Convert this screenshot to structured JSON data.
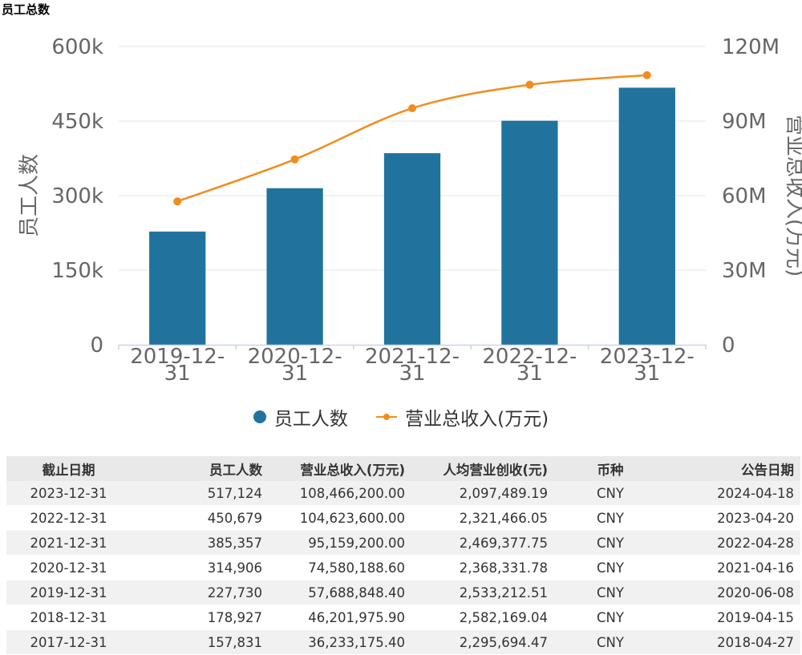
{
  "page_title": "员工总数",
  "chart_data": {
    "type": "bar+line",
    "categories": [
      "2019-12-31",
      "2020-12-31",
      "2021-12-31",
      "2022-12-31",
      "2023-12-31"
    ],
    "category_lines": [
      [
        "2019-12-",
        "31"
      ],
      [
        "2020-12-",
        "31"
      ],
      [
        "2021-12-",
        "31"
      ],
      [
        "2022-12-",
        "31"
      ],
      [
        "2023-12-",
        "31"
      ]
    ],
    "series": [
      {
        "name": "员工人数",
        "type": "bar",
        "axis": "left",
        "values": [
          227730,
          314906,
          385357,
          450679,
          517124
        ],
        "color": "#21739e"
      },
      {
        "name": "营业总收入(万元)",
        "type": "line",
        "axis": "right",
        "values": [
          57688848.4,
          74580188.6,
          95159200.0,
          104623600.0,
          108466200.0
        ],
        "color": "#f28d1d"
      }
    ],
    "ylabel_left": "员工人数",
    "ylabel_right": "营业总收入(万元)",
    "ylim_left": [
      0,
      600000
    ],
    "ylim_right": [
      0,
      120000000
    ],
    "yticks_left": [
      "0",
      "150k",
      "300k",
      "450k",
      "600k"
    ],
    "yticks_right": [
      "0",
      "30M",
      "60M",
      "90M",
      "120M"
    ],
    "grid": true,
    "legend_position": "bottom"
  },
  "table": {
    "headers": [
      "截止日期",
      "员工人数",
      "营业总收入(万元)",
      "人均营业创收(元)",
      "币种",
      "公告日期"
    ],
    "rows": [
      [
        "2023-12-31",
        "517,124",
        "108,466,200.00",
        "2,097,489.19",
        "CNY",
        "2024-04-18"
      ],
      [
        "2022-12-31",
        "450,679",
        "104,623,600.00",
        "2,321,466.05",
        "CNY",
        "2023-04-20"
      ],
      [
        "2021-12-31",
        "385,357",
        "95,159,200.00",
        "2,469,377.75",
        "CNY",
        "2022-04-28"
      ],
      [
        "2020-12-31",
        "314,906",
        "74,580,188.60",
        "2,368,331.78",
        "CNY",
        "2021-04-16"
      ],
      [
        "2019-12-31",
        "227,730",
        "57,688,848.40",
        "2,533,212.51",
        "CNY",
        "2020-06-08"
      ],
      [
        "2018-12-31",
        "178,927",
        "46,201,975.90",
        "2,582,169.04",
        "CNY",
        "2019-04-15"
      ],
      [
        "2017-12-31",
        "157,831",
        "36,233,175.40",
        "2,295,694.47",
        "CNY",
        "2018-04-27"
      ]
    ]
  }
}
